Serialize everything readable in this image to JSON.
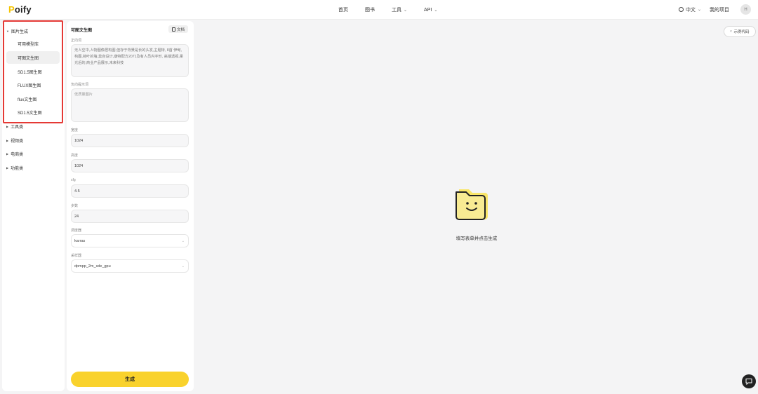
{
  "app": {
    "logo_prefix": "P",
    "logo_rest": "oify"
  },
  "nav": {
    "items": [
      {
        "label": "首页",
        "has_dropdown": false
      },
      {
        "label": "图书",
        "has_dropdown": false
      },
      {
        "label": "工具",
        "has_dropdown": true
      },
      {
        "label": "API",
        "has_dropdown": true
      }
    ]
  },
  "header_right": {
    "language": "中文",
    "my_projects": "我的项目",
    "avatar_initial": "H"
  },
  "sidebar": {
    "group_open": {
      "label": "图片生成"
    },
    "sub_items": [
      {
        "label": "可用模型库",
        "active": false
      },
      {
        "label": "可图文生图",
        "active": true
      },
      {
        "label": "SD1.5图生图",
        "active": false
      },
      {
        "label": "FLUX图生图",
        "active": false
      },
      {
        "label": "flux文生图",
        "active": false
      },
      {
        "label": "SD1.5文生图",
        "active": false
      }
    ],
    "other_groups": [
      "工具类",
      "视频类",
      "电商类",
      "功能类"
    ]
  },
  "form": {
    "title": "可图文生图",
    "doc_button": "文档",
    "prompt": {
      "label": "正向词",
      "value": "无人空中,人物图像居构图,但存于背景是长的头发,主题特, 8首 伊甸,构图,荷叶的墙,莫自设计,康特配方2071及有人员内字形, 高端透视,柔光后的,商业产品展示,未来科技"
    },
    "negative": {
      "label": "负向提示词",
      "placeholder": "低质量图片"
    },
    "width": {
      "label": "宽度",
      "value": "1024"
    },
    "height": {
      "label": "高度",
      "value": "1024"
    },
    "cfg": {
      "label": "cfg",
      "value": "4.5"
    },
    "steps": {
      "label": "步数",
      "value": "24"
    },
    "scheduler": {
      "label": "调度器",
      "value": "karras"
    },
    "sampler": {
      "label": "采样器",
      "value": "dpmpp_2m_sde_gpu"
    },
    "generate_button": "生成"
  },
  "main": {
    "code_button": "示例代码",
    "empty_text": "填写表单并点击生成"
  },
  "colors": {
    "accent_yellow": "#f9d22c",
    "highlight_red": "#e53935"
  }
}
